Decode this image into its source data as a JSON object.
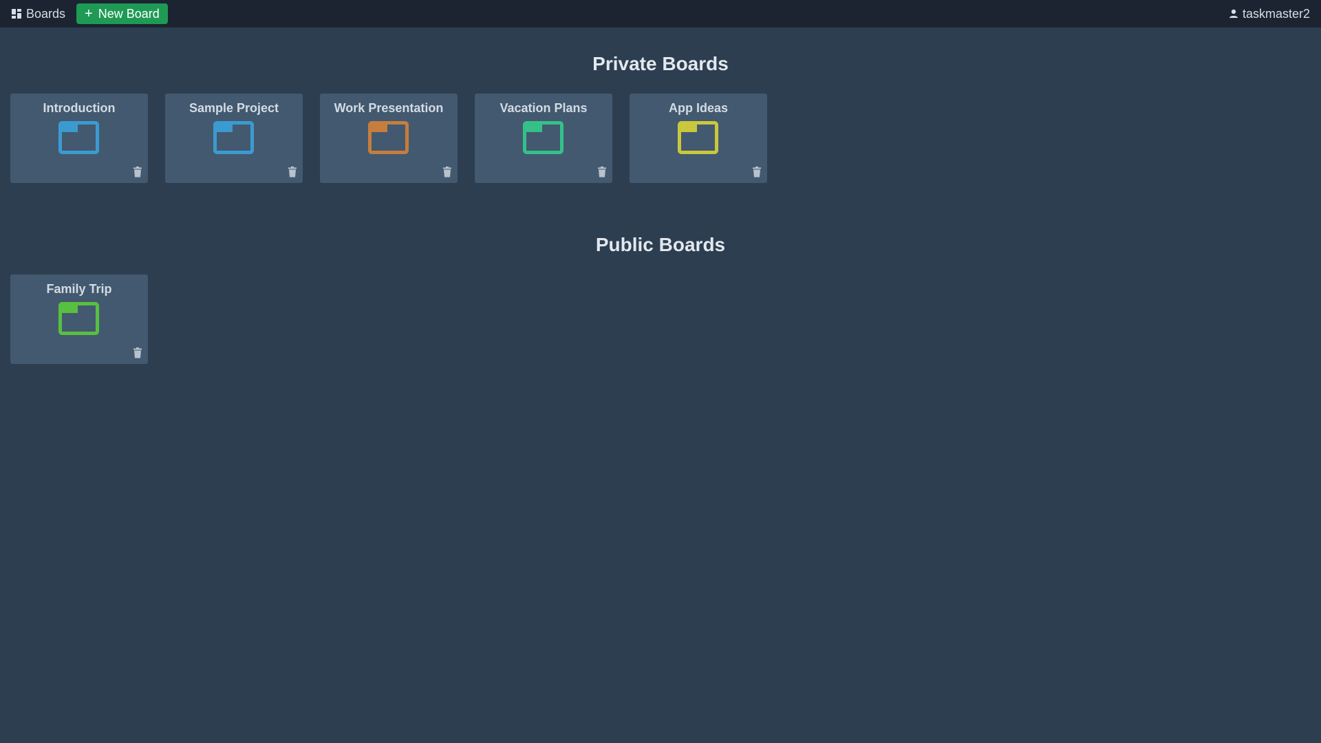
{
  "topbar": {
    "boards_label": "Boards",
    "new_board_label": "New Board",
    "username": "taskmaster2"
  },
  "sections": {
    "private_title": "Private Boards",
    "public_title": "Public Boards"
  },
  "private_boards": [
    {
      "name": "Introduction",
      "color": "#3b9bd1",
      "icon": "folder-icon"
    },
    {
      "name": "Sample Project",
      "color": "#3b9bd1",
      "icon": "folder-icon"
    },
    {
      "name": "Work Presentation",
      "color": "#c67d3e",
      "icon": "folder-icon"
    },
    {
      "name": "Vacation Plans",
      "color": "#35c08a",
      "icon": "folder-icon"
    },
    {
      "name": "App Ideas",
      "color": "#c9c83c",
      "icon": "folder-icon"
    }
  ],
  "public_boards": [
    {
      "name": "Family Trip",
      "color": "#58c040",
      "icon": "folder-icon"
    }
  ],
  "colors": {
    "background": "#2c3e50",
    "topbar": "#1b2430",
    "card": "#43596f",
    "new_board_button": "#1e9a55"
  }
}
